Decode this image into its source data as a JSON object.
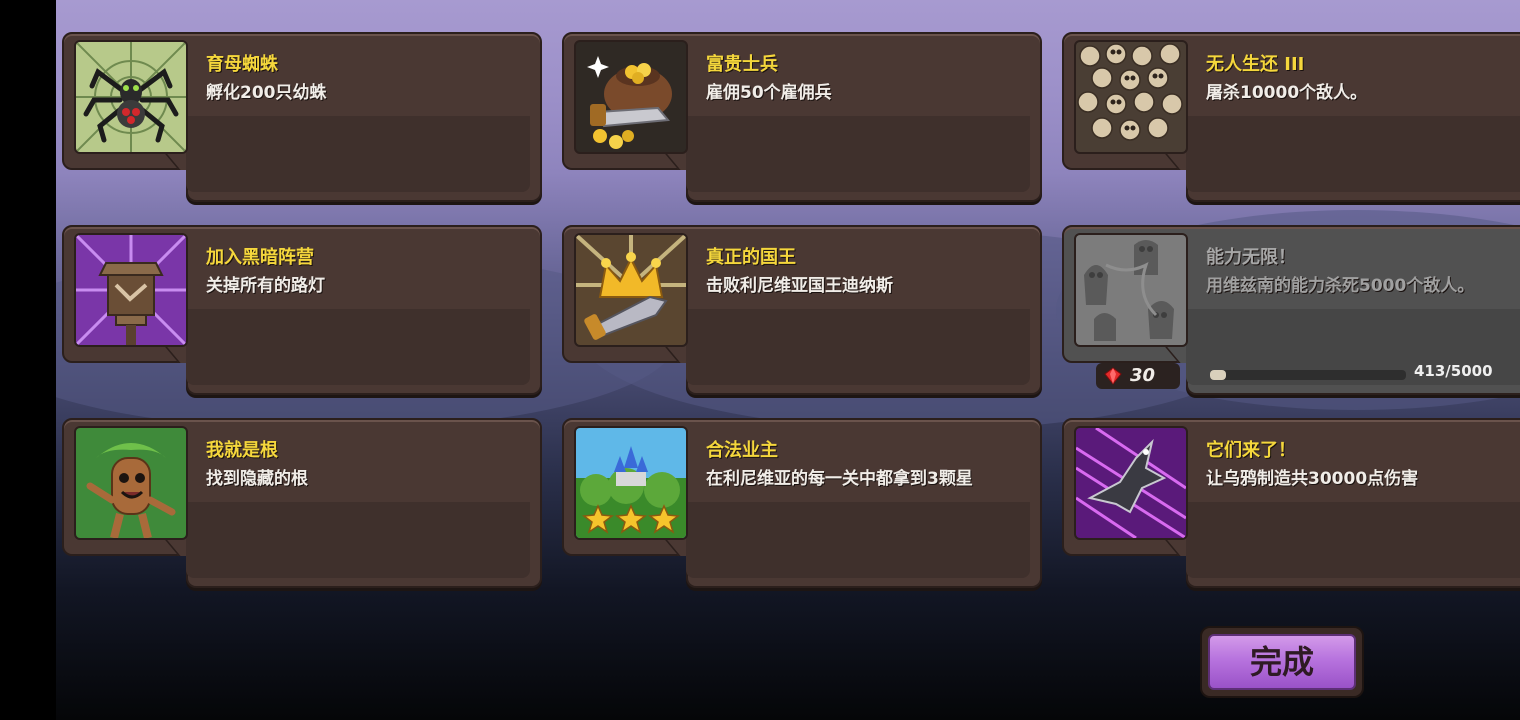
{
  "achievements": [
    {
      "title": "育母蜘蛛",
      "desc": "孵化200只幼蛛",
      "icon": "spider-icon"
    },
    {
      "title": "富贵士兵",
      "desc": "雇佣50个雇佣兵",
      "icon": "gold-sack-icon"
    },
    {
      "title": "无人生还 III",
      "desc": "屠杀10000个敌人。",
      "icon": "skull-pile-icon"
    },
    {
      "title": "加入黑暗阵营",
      "desc": "关掉所有的路灯",
      "icon": "lantern-icon"
    },
    {
      "title": "真正的国王",
      "desc": "击败利尼维亚国王迪纳斯",
      "icon": "crown-sword-icon"
    },
    {
      "title": "能力无限！",
      "desc": "用维兹南的能力杀死5000个敌人。",
      "icon": "shadow-souls-icon",
      "locked": true,
      "reward": "30",
      "progress_text": "413/5000",
      "progress": 0.0826
    },
    {
      "title": "我就是根",
      "desc": "找到隐藏的根",
      "icon": "tree-root-icon"
    },
    {
      "title": "合法业主",
      "desc": "在利尼维亚的每一关中都拿到3颗星",
      "icon": "three-stars-icon"
    },
    {
      "title": "它们来了！",
      "desc": "让乌鸦制造共30000点伤害",
      "icon": "crow-icon"
    }
  ],
  "done_button": "完成",
  "colors": {
    "title": "#f5d73c",
    "desc": "#f1ede8",
    "panel": "#4a3833",
    "button": "#b773de"
  }
}
